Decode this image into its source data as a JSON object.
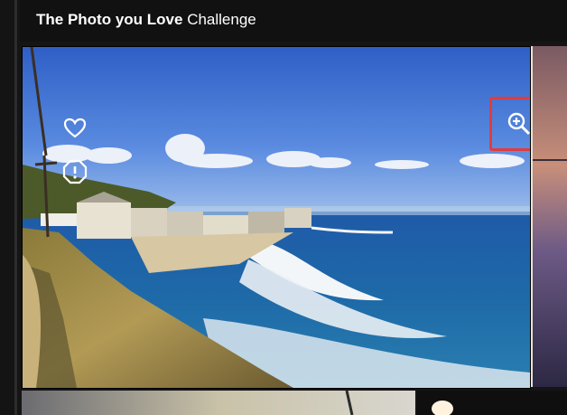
{
  "header": {
    "title_bold": "The Photo you Love",
    "title_rest": "Challenge"
  },
  "photo": {
    "subject": "coastal cliffs with beach houses and waves",
    "actions": {
      "like_icon": "heart-outline-icon",
      "report_icon": "report-octagon-icon",
      "zoom_icon": "zoom-in-icon"
    }
  },
  "colors": {
    "header_bg": "#111111",
    "highlight": "#e23c3c",
    "page_bg": "#151515"
  }
}
